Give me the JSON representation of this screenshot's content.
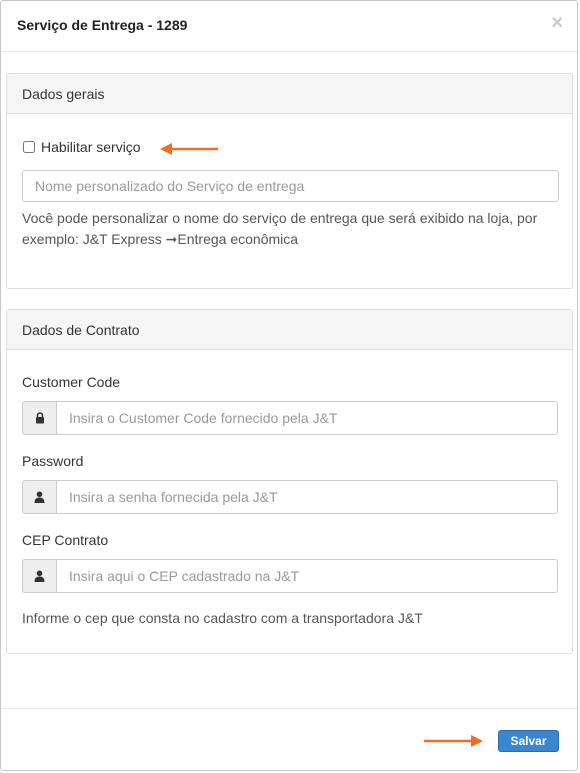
{
  "modal": {
    "title": "Serviço de Entrega - 1289",
    "close_label": "×"
  },
  "general_panel": {
    "heading": "Dados gerais",
    "enable_service_label": "Habilitar serviço",
    "enable_service_checked": false,
    "service_name": {
      "value": "",
      "placeholder": "Nome personalizado do Serviço de entrega"
    },
    "help_line1": "Você pode personalizar o nome do serviço de entrega que será exibido na loja, por",
    "help_line2": "exemplo: J&T Express ➞Entrega econômica"
  },
  "contract_panel": {
    "heading": "Dados de Contrato",
    "customer_code": {
      "label": "Customer Code",
      "value": "",
      "placeholder": "Insira o Customer Code fornecido pela J&T",
      "icon": "lock-icon"
    },
    "password": {
      "label": "Password",
      "value": "",
      "placeholder": "Insira a senha fornecida pela J&T",
      "icon": "user-icon"
    },
    "cep": {
      "label": "CEP Contrato",
      "value": "",
      "placeholder": "Insira aqui o CEP cadastrado na J&T",
      "icon": "user-icon"
    },
    "cep_help": "Informe o cep que consta no cadastro com a transportadora J&T"
  },
  "footer": {
    "save_label": "Salvar"
  },
  "colors": {
    "accent_arrow": "#f26d21",
    "save_button": "#3a87cf",
    "panel_heading_bg": "#f5f5f5"
  }
}
